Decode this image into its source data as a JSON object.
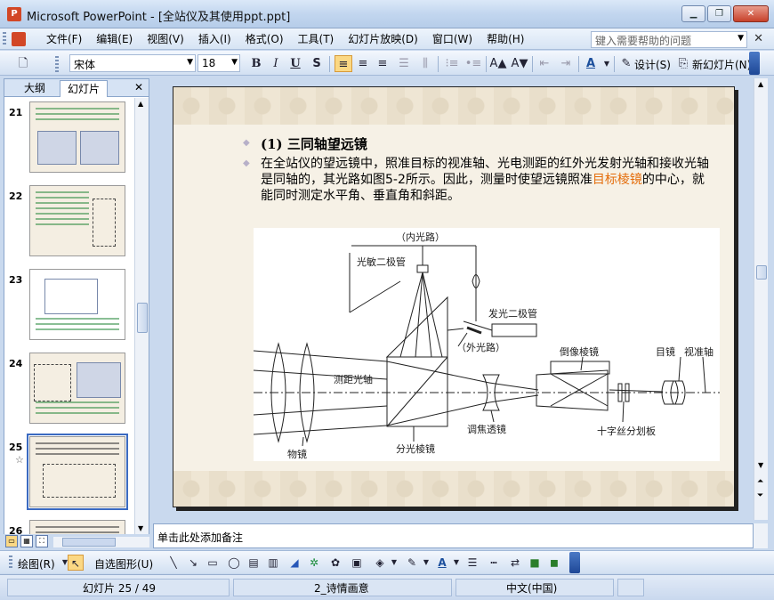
{
  "window": {
    "title": "Microsoft PowerPoint - [全站仪及其使用ppt.ppt]",
    "minimize": "▁",
    "restore": "❐",
    "close": "✕"
  },
  "menu": {
    "items": [
      "文件(F)",
      "编辑(E)",
      "视图(V)",
      "插入(I)",
      "格式(O)",
      "工具(T)",
      "幻灯片放映(D)",
      "窗口(W)",
      "帮助(H)"
    ],
    "help_placeholder": "键入需要帮助的问题",
    "close": "✕"
  },
  "toolbar": {
    "font_name": "宋体",
    "font_size": "18",
    "bold": "B",
    "italic": "I",
    "underline": "U",
    "shadow": "S",
    "design_label": "设计(S)",
    "new_slide_label": "新幻灯片(N)"
  },
  "left_panel": {
    "tab_outline": "大纲",
    "tab_slides": "幻灯片",
    "close": "✕",
    "thumbnails": [
      {
        "num": "21"
      },
      {
        "num": "22"
      },
      {
        "num": "23"
      },
      {
        "num": "24"
      },
      {
        "num": "25",
        "star": "☆"
      },
      {
        "num": "26"
      }
    ]
  },
  "slide": {
    "heading": "(1) 三同轴望远镜",
    "body_part1": "在全站仪的望远镜中，照准目标的视准轴、光电测距的红外光发射光轴和接收光轴是同轴的，其光路如图5-2所示。因此，测量时使望远镜照准",
    "body_highlight": "目标棱镜",
    "body_part2": "的中心，就能同时测定水平角、垂直角和斜距。",
    "diagram_labels": {
      "inner_path": "（内光路）",
      "photo_diode": "光敏二极管",
      "emit_diode": "发光二极管",
      "outer_path": "（外光路）",
      "range_axis": "测距光轴",
      "inverting_prism": "倒像棱镜",
      "eyepiece": "目镜",
      "sight_axis": "视准轴",
      "focus_lens": "调焦透镜",
      "objective": "物镜",
      "split_prism": "分光棱镜",
      "reticle": "十字丝分划板"
    }
  },
  "notes": {
    "placeholder": "单击此处添加备注"
  },
  "draw_toolbar": {
    "draw_label": "绘图(R)",
    "autoshape_label": "自选图形(U)"
  },
  "status": {
    "slide_pos": "幻灯片 25 / 49",
    "design": "2_诗情画意",
    "language": "中文(中国)"
  },
  "colors": {
    "highlight_text": "#e46c0a",
    "selection": "#3b6ac1",
    "active_button": "#fbd884"
  }
}
